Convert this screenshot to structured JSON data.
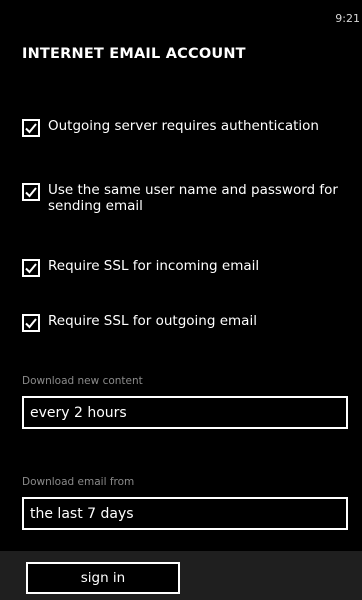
{
  "status_bar": {
    "time": "9:21"
  },
  "page": {
    "title": "INTERNET EMAIL ACCOUNT"
  },
  "options": [
    {
      "label": "Outgoing server requires authentication",
      "checked": true
    },
    {
      "label": "Use the same user name and password for sending email",
      "checked": true
    },
    {
      "label": "Require SSL for incoming email",
      "checked": true
    },
    {
      "label": "Require SSL for outgoing email",
      "checked": true
    }
  ],
  "download_content": {
    "label": "Download new content",
    "value": "every 2 hours"
  },
  "download_email": {
    "label": "Download email from",
    "value": "the last 7 days"
  },
  "app_bar": {
    "sign_in_label": "sign in"
  }
}
